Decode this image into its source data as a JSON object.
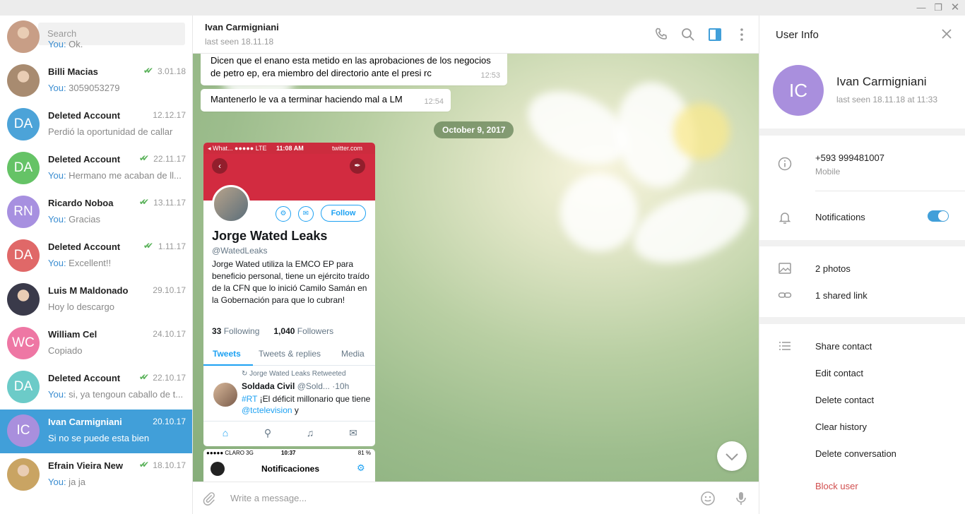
{
  "window": {
    "min_icon": "minimize-icon",
    "restore_icon": "restore-icon"
  },
  "sidebar": {
    "search_placeholder": "Search",
    "chats": [
      {
        "initials": "",
        "avatar_type": "photo",
        "color": "#c89e86",
        "name": "",
        "date": "",
        "you": "You:",
        "msg": " Ok.",
        "read": false
      },
      {
        "initials": "",
        "avatar_type": "photo",
        "color": "#a88b70",
        "name": "Billi Macias",
        "date": "3.01.18",
        "you": "You:",
        "msg": " 3059053279",
        "read": true
      },
      {
        "initials": "DA",
        "avatar_type": "initials",
        "color": "#4ca3d8",
        "name": "Deleted Account",
        "date": "12.12.17",
        "you": "",
        "msg": "Perdió la oportunidad de callar",
        "read": false
      },
      {
        "initials": "DA",
        "avatar_type": "initials",
        "color": "#65c366",
        "name": "Deleted Account",
        "date": "22.11.17",
        "you": "You:",
        "msg": " Hermano me acaban de ll...",
        "read": true
      },
      {
        "initials": "RN",
        "avatar_type": "initials",
        "color": "#a790e0",
        "name": "Ricardo Noboa",
        "date": "13.11.17",
        "you": "You:",
        "msg": " Gracias",
        "read": true
      },
      {
        "initials": "DA",
        "avatar_type": "initials",
        "color": "#e06868",
        "name": "Deleted Account",
        "date": "1.11.17",
        "you": "You:",
        "msg": " Excellent!!",
        "read": true
      },
      {
        "initials": "",
        "avatar_type": "photo",
        "color": "#3a3a4a",
        "name": "Luis M Maldonado",
        "date": "29.10.17",
        "you": "",
        "msg": "Hoy lo descargo",
        "read": false
      },
      {
        "initials": "WC",
        "avatar_type": "initials",
        "color": "#ee77a4",
        "name": "William Cel",
        "date": "24.10.17",
        "you": "",
        "msg": "Copiado",
        "read": false
      },
      {
        "initials": "DA",
        "avatar_type": "initials",
        "color": "#6ccbc8",
        "name": "Deleted Account",
        "date": "22.10.17",
        "you": "You:",
        "msg": " si, ya tengoun caballo de t...",
        "read": true
      },
      {
        "initials": "IC",
        "avatar_type": "initials",
        "color": "#a98fdd",
        "name": "Ivan Carmigniani",
        "date": "20.10.17",
        "you": "",
        "msg": "Si no se puede esta bien",
        "read": false,
        "active": true
      },
      {
        "initials": "",
        "avatar_type": "photo",
        "color": "#c9a463",
        "name": "Efrain Vieira New",
        "date": "18.10.17",
        "you": "You:",
        "msg": " ja ja",
        "read": true
      }
    ]
  },
  "header": {
    "name": "Ivan Carmigniani",
    "status": "last seen 18.11.18"
  },
  "messages": [
    {
      "text": "Dicen que el enano esta metido en las aprobaciones de los negocios de petro ep, era miembro del directorio ante el presi rc",
      "time": "12:53"
    },
    {
      "text": "Mantenerlo le va a terminar  haciendo mal a LM",
      "time": "12:54"
    }
  ],
  "date_divider": "October 9, 2017",
  "photo_tweet": {
    "status_left": "◂ What... ●●●●● LTE",
    "status_time": "11:08 AM",
    "status_right": "twitter.com",
    "follow": "Follow",
    "name": "Jorge Wated Leaks",
    "handle": "@WatedLeaks",
    "bio": "Jorge Wated utiliza la EMCO EP para beneficio personal, tiene un ejército traído de la CFN que lo inició Camilo Samán en la Gobernación para que lo cubran!",
    "following_count": "33",
    "following_label": " Following",
    "followers_count": "1,040",
    "followers_label": " Followers",
    "tabs": [
      "Tweets",
      "Tweets & replies",
      "Media"
    ],
    "retweet_label": "Jorge Wated Leaks Retweeted",
    "tweet_author": "Soldada Civil",
    "tweet_handle": " @Sold... ·10h",
    "tweet_hashtag": "#RT",
    "tweet_text": " ¡El déficit millonario que tiene ",
    "tweet_mention": "@tctelevision",
    "tweet_tail": " y"
  },
  "photo_notif": {
    "status_left": "●●●●● CLARO  3G",
    "status_time": "10:37",
    "status_right": "81 %",
    "title": "Notificaciones"
  },
  "composer": {
    "placeholder": "Write a message..."
  },
  "user_info": {
    "title": "User Info",
    "initials": "IC",
    "name": "Ivan Carmigniani",
    "last_seen": "last seen 18.11.18 at 11:33",
    "phone": "+593 999481007",
    "phone_label": "Mobile",
    "notifications_label": "Notifications",
    "notifications_on": true,
    "photos": "2 photos",
    "shared_links": "1 shared link",
    "actions": [
      "Share contact",
      "Edit contact",
      "Delete contact",
      "Clear history",
      "Delete conversation"
    ],
    "block": "Block user"
  },
  "colors": {
    "accent": "#419fd9",
    "check": "#5ab25a",
    "danger": "#d14e4e"
  }
}
